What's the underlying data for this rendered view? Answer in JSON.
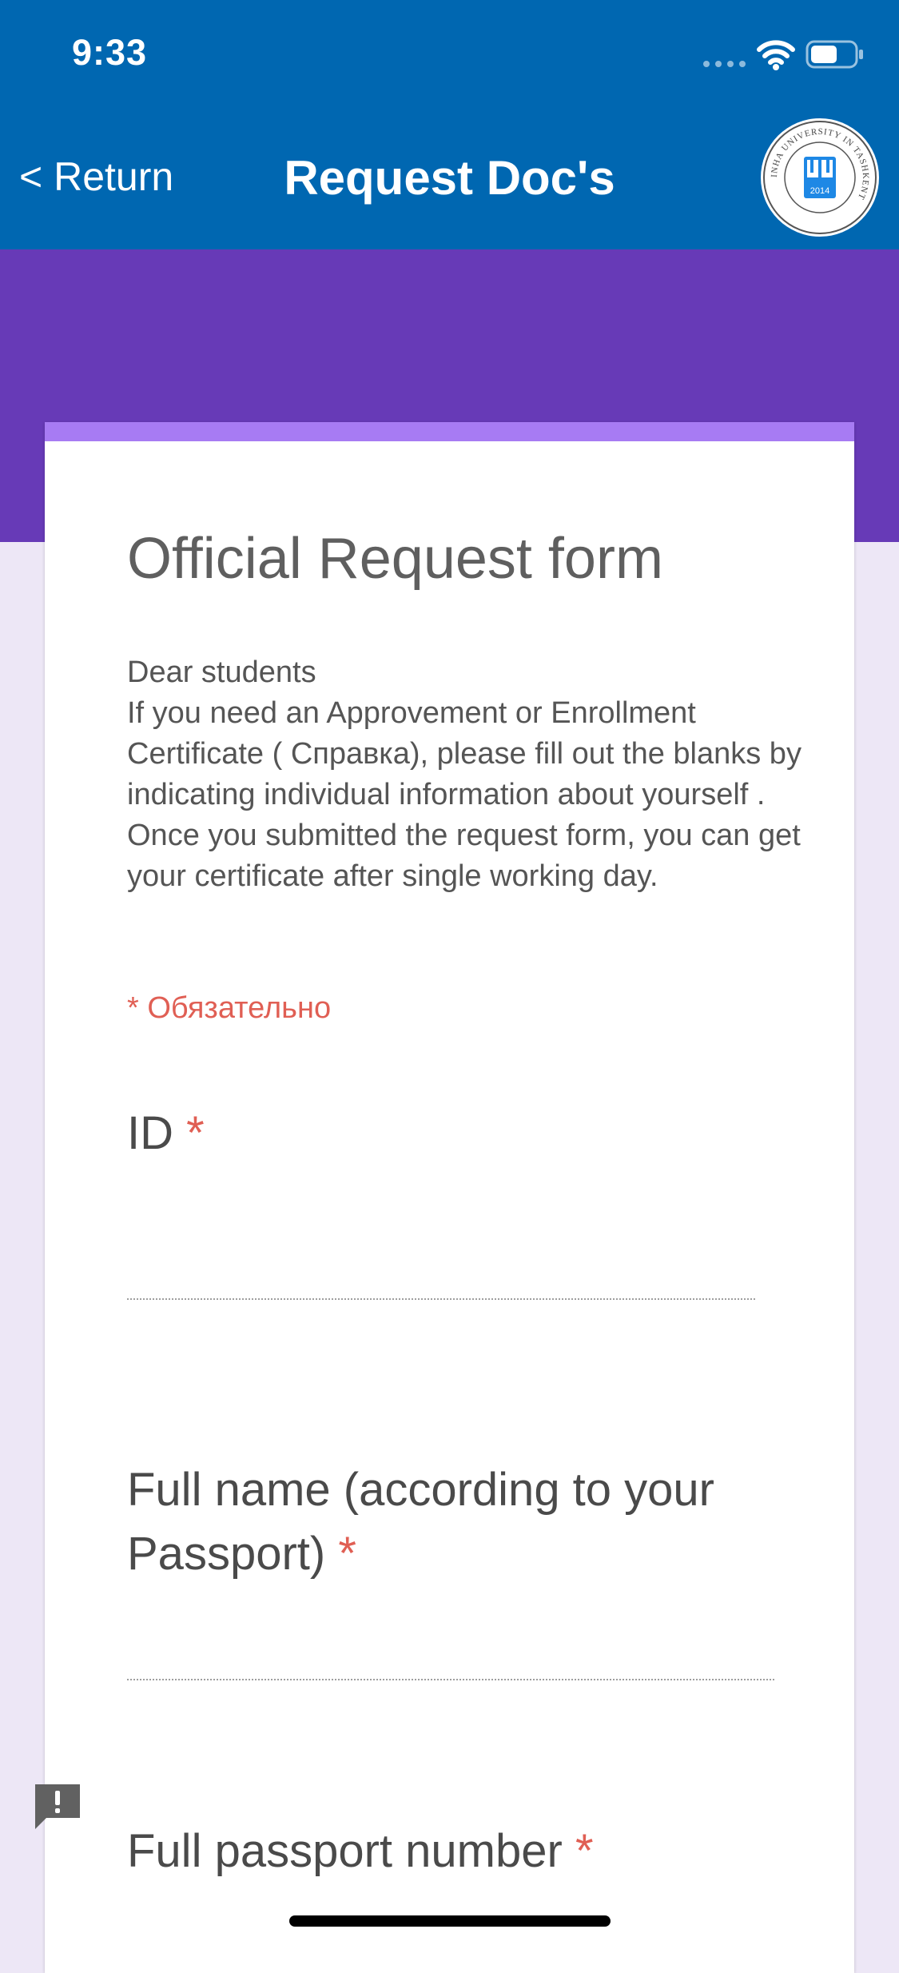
{
  "status_bar": {
    "time": "9:33"
  },
  "nav": {
    "return_label": "< Return",
    "title": "Request Doc's"
  },
  "logo": {
    "text": "INHA UNIVERSITY IN TASHKENT",
    "year": "2014"
  },
  "form": {
    "title": "Official Request form",
    "description": "Dear students\nIf you need an Approvement or Enrollment Certificate ( Справка), please fill out the blanks by indicating individual information about yourself .\nOnce you submitted the request form, you can get your certificate after single working day.",
    "required_note": "* Обязательно",
    "questions": [
      {
        "label": "ID",
        "required_mark": "*"
      },
      {
        "label": "Full name (according to your Passport)",
        "required_mark": "*"
      },
      {
        "label": "Full passport number",
        "required_mark": "*"
      }
    ]
  },
  "colors": {
    "nav_blue": "#0067b1",
    "form_purple": "#673ab7",
    "card_accent": "#a77bf3",
    "page_background": "#ede7f6",
    "required_red": "#db4437"
  },
  "icons": {
    "wifi": "wifi-icon",
    "battery": "battery-icon",
    "feedback": "feedback-icon",
    "logo": "university-logo"
  }
}
